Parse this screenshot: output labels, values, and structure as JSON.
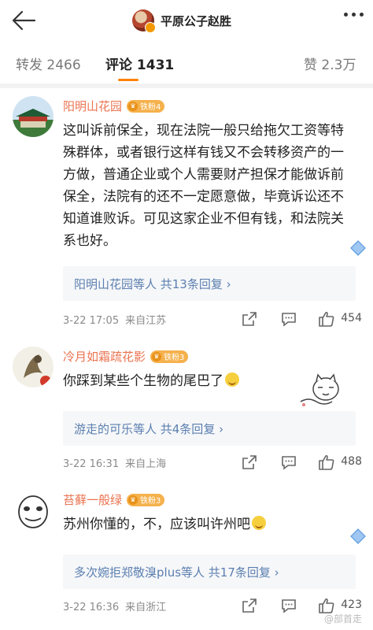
{
  "header": {
    "title": "平原公子赵胜",
    "back_icon": "back-arrow-icon",
    "more_icon": "more-dots-icon"
  },
  "tabs": [
    {
      "label": "转发 2466"
    },
    {
      "label": "评论 1431"
    },
    {
      "label": "赞 2.3万"
    }
  ],
  "comments": [
    {
      "user": "阳明山花园",
      "badge": "铁粉4",
      "text": "这叫诉前保全，现在法院一般只给拖欠工资等特殊群体，或者银行这样有钱又不会转移资产的一方做，普通企业或个人需要财产担保才能做诉前保全，法院有的还不一定愿意做，毕竟诉讼还不知道谁败诉。可见这家企业不但有钱，和法院关系也好。",
      "reply_summary": "阳明山花园等人 共13条回复 ›",
      "time": "3-22 17:05",
      "location": "来自江苏",
      "likes": "454"
    },
    {
      "user": "冷月如霜疏花影",
      "badge": "铁粉3",
      "text": "你踩到某些个生物的尾巴了",
      "reply_summary": "游走的可乐等人 共4条回复 ›",
      "time": "3-22 16:31",
      "location": "来自上海",
      "likes": "488"
    },
    {
      "user": "苔藓一般绿",
      "badge": "铁粉3",
      "text": "苏州你懂的，不，应该叫许州吧",
      "reply_summary": "多次婉拒郑敬溴plus等人 共17条回复 ›",
      "time": "3-22 16:36",
      "location": "来自浙江",
      "likes": "423"
    }
  ],
  "watermark": "@部首走",
  "colors": {
    "accent": "#ff8200",
    "username": "#eb7350",
    "link": "#5b7fb0"
  }
}
